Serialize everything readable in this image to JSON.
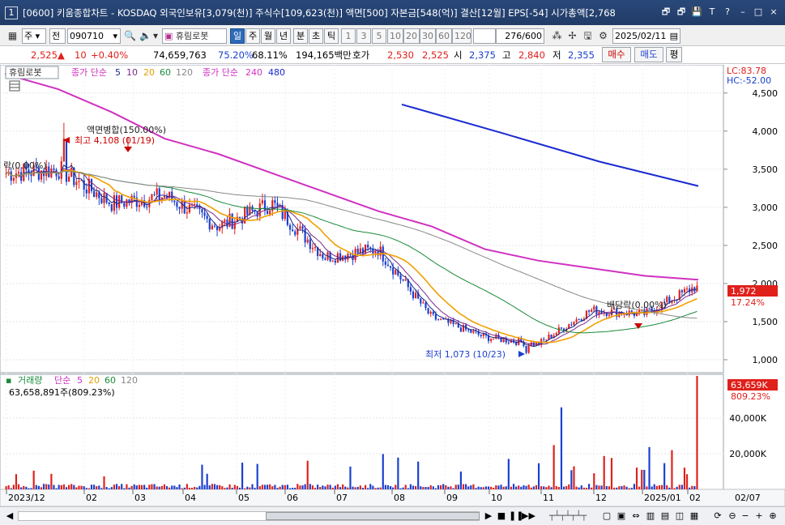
{
  "window": {
    "number": "1",
    "title": "[0600] 키움종합차트 - KOSDAQ 외국인보유[3,079(천)] 주식수[109,623(천)] 액면[500] 자본금[548(억)] 결산[12월] EPS[-54] 시가총액[2,768",
    "buttons": [
      "🗗",
      "🗗",
      "💾",
      "T",
      "?",
      "–",
      "□",
      "×"
    ]
  },
  "toolbar": {
    "period": "주",
    "mode": "전",
    "code": "090710",
    "stock_name": "휴림로봇",
    "tabs": [
      "일",
      "주",
      "월",
      "년",
      "분",
      "초",
      "틱"
    ],
    "active_tab": "일",
    "intervals": [
      "1",
      "3",
      "5",
      "10",
      "20",
      "30",
      "60",
      "120"
    ],
    "count": "276",
    "count_total": "/600",
    "date": "2025/02/11"
  },
  "quote": {
    "price": "2,525",
    "arrow": "▲",
    "change": "10",
    "change_pct": "+0.40%",
    "volume": "74,659,763",
    "ratio1": "75.20%",
    "ratio2": "68.11%",
    "amount": "194,165백만",
    "ask_label": "호가",
    "ask": "2,530",
    "bid": "2,525",
    "open_label": "시",
    "open": "2,375",
    "high_label": "고",
    "high": "2,840",
    "low_label": "저",
    "low": "2,355",
    "buy_btn": "매수",
    "sell_btn": "매도",
    "flat_btn": "평"
  },
  "legend": {
    "price_name": "휴림로봇",
    "ma_label": "종가 단순",
    "ma_periods": [
      "5",
      "10",
      "20",
      "60",
      "120"
    ],
    "ma_long_label": "종가 단순",
    "ma_long_periods": [
      "240",
      "480"
    ],
    "volume_name": "거래량",
    "vol_ma_label": "단순",
    "vol_ma_periods": [
      "5",
      "20",
      "60",
      "120"
    ],
    "volume_value": "63,658,891주(809.23%)"
  },
  "right_info": {
    "lc": "LC:83.78",
    "hc": "HC:-52.00",
    "price_tag": "1,972",
    "price_tag_pct": "17.24%",
    "vol_tag": "63,659K",
    "vol_tag_pct": "809.23%"
  },
  "annotations": {
    "split": "액면병합(150.00%)",
    "high": "최고 4,108 (01/19)",
    "left_cut": "락(0.00%)",
    "low": "최저 1,073 (10/23)",
    "dividend": "배당락(0.00%)"
  },
  "colors": {
    "up": "#e0201b",
    "down": "#1a3fd0",
    "ma5": "#1a2a8a",
    "ma10": "#7a2a8a",
    "ma20": "#f0a000",
    "ma60": "#1a8a3a",
    "ma120": "#888888",
    "ma240": "#d030c0",
    "ma480": "#1a2ad0"
  },
  "chart_data": {
    "type": "candlestick",
    "y_axis_ticks": [
      "4,500",
      "4,000",
      "3,500",
      "3,000",
      "2,500",
      "2,000",
      "1,500",
      "1,000"
    ],
    "y_ticks_values": [
      4500,
      4000,
      3500,
      3000,
      2500,
      2000,
      1500,
      1000
    ],
    "ylim": [
      830,
      4870
    ],
    "volume_ticks": [
      "40,000K",
      "20,000K"
    ],
    "volume_ticks_values": [
      40000,
      20000
    ],
    "volume_ylim": [
      0,
      63659
    ],
    "x_axis_labels": [
      "2023/12",
      "02",
      "03",
      "04",
      "05",
      "06",
      "07",
      "08",
      "09",
      "10",
      "11",
      "12",
      "2025/01",
      "02",
      "02/07"
    ],
    "price_trend": {
      "x": [
        "2023/12",
        "02",
        "03",
        "04",
        "05",
        "06",
        "07",
        "08",
        "09",
        "10",
        "11",
        "12",
        "2025/01",
        "02"
      ],
      "close": [
        3450,
        3500,
        3050,
        3150,
        2750,
        3050,
        2350,
        2450,
        1560,
        1300,
        1200,
        1650,
        1600,
        1972
      ]
    },
    "high_point": {
      "date": "01/19",
      "value": 4108
    },
    "low_point": {
      "date": "10/23",
      "value": 1073
    },
    "ma240": [
      4750,
      4550,
      4250,
      3900,
      3700,
      3450,
      3200,
      2950,
      2750,
      2450,
      2300,
      2200,
      2100,
      2050
    ],
    "ma480_segment": [
      4350,
      3980,
      3600,
      3280
    ]
  }
}
